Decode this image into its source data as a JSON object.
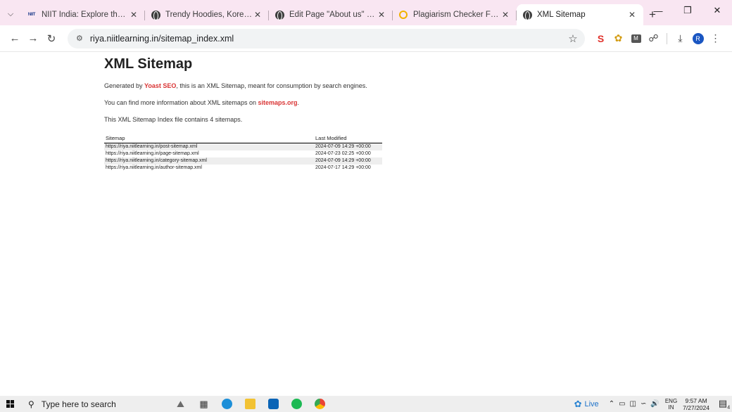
{
  "browser": {
    "tabs": [
      {
        "title": "NIIT India: Explore the Best C",
        "favicon": "niit-logo",
        "favicon_text": "NIIT",
        "active": false
      },
      {
        "title": "Trendy Hoodies, Korean Outf",
        "favicon": "globe-icon",
        "active": false
      },
      {
        "title": "Edit Page \"About us\" ‹ Bliss",
        "favicon": "globe-icon",
        "active": false
      },
      {
        "title": "Plagiarism Checker Free | Ac",
        "favicon": "plagiarism-icon",
        "active": false
      },
      {
        "title": "XML Sitemap",
        "favicon": "globe-icon",
        "active": true
      }
    ],
    "tab_close_glyph": "✕",
    "new_tab_glyph": "+",
    "url": "riya.niitlearning.in/sitemap_index.xml",
    "profile_initial": "R",
    "chrome_color": "#f9e6f2"
  },
  "page": {
    "title": "XML Sitemap",
    "intro": {
      "before": "Generated by ",
      "link": "Yoast SEO",
      "after": ", this is an XML Sitemap, meant for consumption by search engines."
    },
    "info": {
      "before": "You can find more information about XML sitemaps on ",
      "link": "sitemaps.org",
      "after": "."
    },
    "count_text": "This XML Sitemap Index file contains 4 sitemaps.",
    "link_color": "#d93434",
    "table": {
      "headers": [
        "Sitemap",
        "Last Modified"
      ],
      "rows": [
        {
          "url": "https://riya.niitlearning.in/post-sitemap.xml",
          "modified": "2024-07-09 14:29 +00:00"
        },
        {
          "url": "https://riya.niitlearning.in/page-sitemap.xml",
          "modified": "2024-07-23 02:25 +00:00"
        },
        {
          "url": "https://riya.niitlearning.in/category-sitemap.xml",
          "modified": "2024-07-09 14:29 +00:00"
        },
        {
          "url": "https://riya.niitlearning.in/author-sitemap.xml",
          "modified": "2024-07-17 14:29 +00:00"
        }
      ]
    }
  },
  "taskbar": {
    "search_placeholder": "Type here to search",
    "live_label": "Live",
    "lang_top": "ENG",
    "lang_bottom": "IN",
    "time": "9:57 AM",
    "date": "7/27/2024",
    "notification_count": "4"
  }
}
